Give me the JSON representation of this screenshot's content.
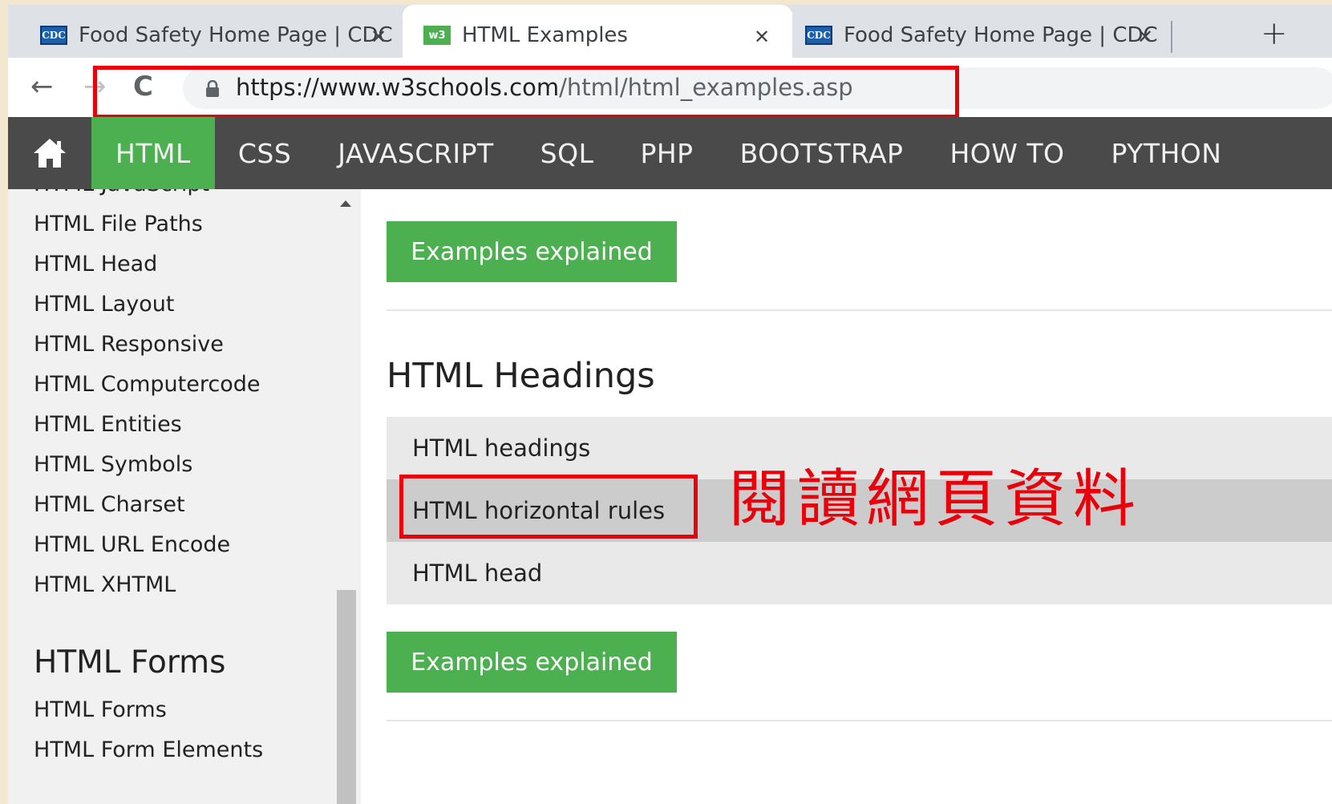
{
  "browser": {
    "tabs": [
      {
        "title": "Food Safety Home Page | CDC",
        "favicon": "cdc-favicon",
        "active": false
      },
      {
        "title": "HTML Examples",
        "favicon": "w3schools-favicon",
        "active": true
      },
      {
        "title": "Food Safety Home Page | CDC",
        "favicon": "cdc-favicon",
        "active": false
      }
    ],
    "favicon_text": {
      "cdc": "CDC",
      "w3": "w3"
    },
    "close_glyph": "✕",
    "new_tab_glyph": "+",
    "back_glyph": "←",
    "forward_glyph": "→",
    "reload_glyph": "C",
    "url": {
      "host": "https://www.w3schools.com",
      "path": "/html/html_examples.asp"
    }
  },
  "site_nav": {
    "items": [
      "HTML",
      "CSS",
      "JAVASCRIPT",
      "SQL",
      "PHP",
      "BOOTSTRAP",
      "HOW TO",
      "PYTHON"
    ],
    "active": "HTML"
  },
  "sidebar": {
    "cut_item": "HTML JavaScript",
    "items": [
      "HTML File Paths",
      "HTML Head",
      "HTML Layout",
      "HTML Responsive",
      "HTML Computercode",
      "HTML Entities",
      "HTML Symbols",
      "HTML Charset",
      "HTML URL Encode",
      "HTML XHTML"
    ],
    "forms_heading": "HTML Forms",
    "forms_items": [
      "HTML Forms",
      "HTML Form Elements"
    ]
  },
  "main": {
    "button_label": "Examples explained",
    "section_title": "HTML Headings",
    "examples": [
      "HTML headings",
      "HTML horizontal rules",
      "HTML head"
    ],
    "hovered_index": 1
  },
  "annotation": {
    "text": "閱讀網頁資料"
  },
  "colors": {
    "w3_green": "#4caf50",
    "nav_dark": "#4a4a4a",
    "highlight_red": "#e8000b"
  }
}
